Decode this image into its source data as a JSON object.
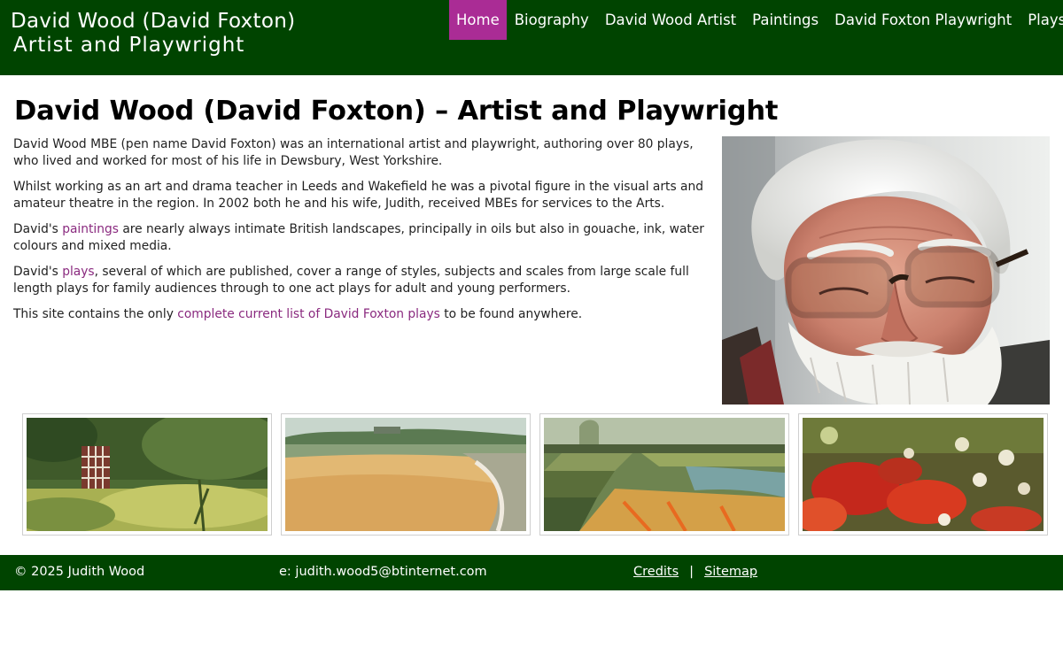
{
  "header": {
    "title_line1": "David Wood (David Foxton)",
    "title_line2": "Artist and Playwright"
  },
  "nav": {
    "items": [
      {
        "label": "Home",
        "active": true
      },
      {
        "label": "Biography"
      },
      {
        "label": "David Wood Artist"
      },
      {
        "label": "Paintings"
      },
      {
        "label": "David Foxton Playwright"
      },
      {
        "label": "Plays"
      }
    ],
    "active_color": "#aa2c95"
  },
  "main": {
    "title": "David Wood (David Foxton) – Artist and Playwright",
    "p1": "David Wood MBE (pen name David Foxton) was an international artist and playwright, authoring over 80 plays, who lived and worked for most of his life in Dewsbury, West Yorkshire.",
    "p2": "Whilst working as an art and drama teacher in Leeds and Wakefield he was a pivotal figure in the visual arts and amateur theatre in the region. In 2002 both he and his wife, Judith, received MBEs for services to the Arts.",
    "p3": {
      "before": "David's ",
      "link": "paintings",
      "after": " are nearly always intimate British landscapes, principally in oils but also in gouache, ink, water colours and mixed media."
    },
    "p4": {
      "before": "David's ",
      "link": "plays",
      "after": ", several of which are published, cover a range of styles, subjects and scales from large scale full length plays for family audiences through to one act plays for adult and young performers."
    },
    "p5": {
      "before": "This site contains the only ",
      "link": "complete current list of David Foxton plays",
      "after": " to be found anywhere."
    },
    "link_color": "#8a2a7f"
  },
  "gallery": {
    "thumbnails": [
      {
        "subject": "garden doorway with trellis and greenery"
      },
      {
        "subject": "wheat field with hilltop abbey"
      },
      {
        "subject": "formal garden with topiary and flowers"
      },
      {
        "subject": "red and white wildflowers"
      }
    ]
  },
  "footer": {
    "copyright": "© 2025 Judith Wood",
    "email": "e: judith.wood5@btinternet.com",
    "credits": "Credits",
    "separator": "|",
    "sitemap": "Sitemap"
  },
  "colors": {
    "header_bg": "#004400",
    "footer_bg": "#004400"
  }
}
